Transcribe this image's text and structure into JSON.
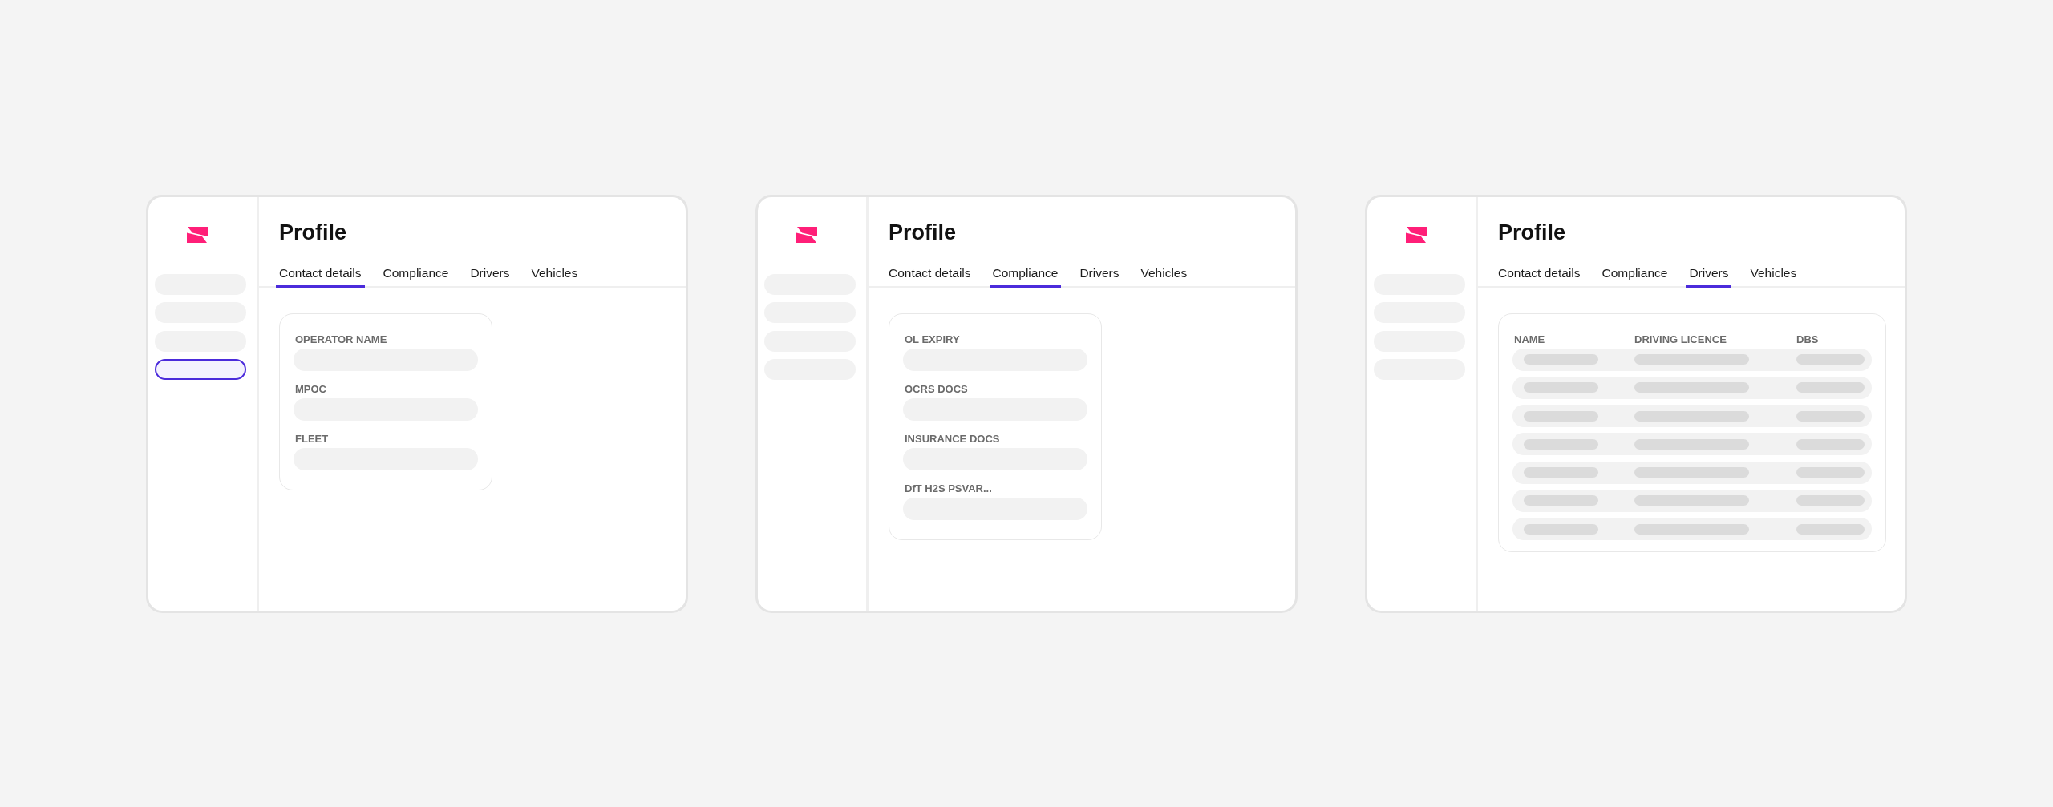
{
  "frames": [
    {
      "sidebar": {
        "items": [
          {
            "selected": false
          },
          {
            "selected": false
          },
          {
            "selected": false
          },
          {
            "selected": true
          }
        ]
      },
      "title": "Profile",
      "tabs": [
        {
          "label": "Contact details",
          "selected": true
        },
        {
          "label": "Compliance",
          "selected": false
        },
        {
          "label": "Drivers",
          "selected": false
        },
        {
          "label": "Vehicles",
          "selected": false
        }
      ],
      "content": {
        "kind": "form",
        "fields": [
          {
            "label": "OPERATOR NAME"
          },
          {
            "label": "MPOC"
          },
          {
            "label": "FLEET"
          }
        ]
      }
    },
    {
      "sidebar": {
        "items": [
          {
            "selected": false
          },
          {
            "selected": false
          },
          {
            "selected": false
          },
          {
            "selected": false
          }
        ]
      },
      "title": "Profile",
      "tabs": [
        {
          "label": "Contact details",
          "selected": false
        },
        {
          "label": "Compliance",
          "selected": true
        },
        {
          "label": "Drivers",
          "selected": false
        },
        {
          "label": "Vehicles",
          "selected": false
        }
      ],
      "content": {
        "kind": "form",
        "fields": [
          {
            "label": "OL EXPIRY"
          },
          {
            "label": "OCRS DOCS"
          },
          {
            "label": "INSURANCE DOCS"
          },
          {
            "label": "DfT H2S PSVAR..."
          }
        ]
      }
    },
    {
      "sidebar": {
        "items": [
          {
            "selected": false
          },
          {
            "selected": false
          },
          {
            "selected": false
          },
          {
            "selected": false
          }
        ]
      },
      "title": "Profile",
      "tabs": [
        {
          "label": "Contact details",
          "selected": false
        },
        {
          "label": "Compliance",
          "selected": false
        },
        {
          "label": "Drivers",
          "selected": true
        },
        {
          "label": "Vehicles",
          "selected": false
        }
      ],
      "content": {
        "kind": "table",
        "columns": [
          "NAME",
          "DRIVING LICENCE",
          "DBS"
        ],
        "rows": [
          {
            "kind": "skeleton"
          },
          {
            "kind": "skeleton"
          },
          {
            "kind": "skeleton"
          },
          {
            "kind": "skeleton"
          },
          {
            "kind": "skeleton"
          },
          {
            "kind": "skeleton"
          },
          {
            "kind": "skeleton"
          }
        ]
      }
    }
  ]
}
